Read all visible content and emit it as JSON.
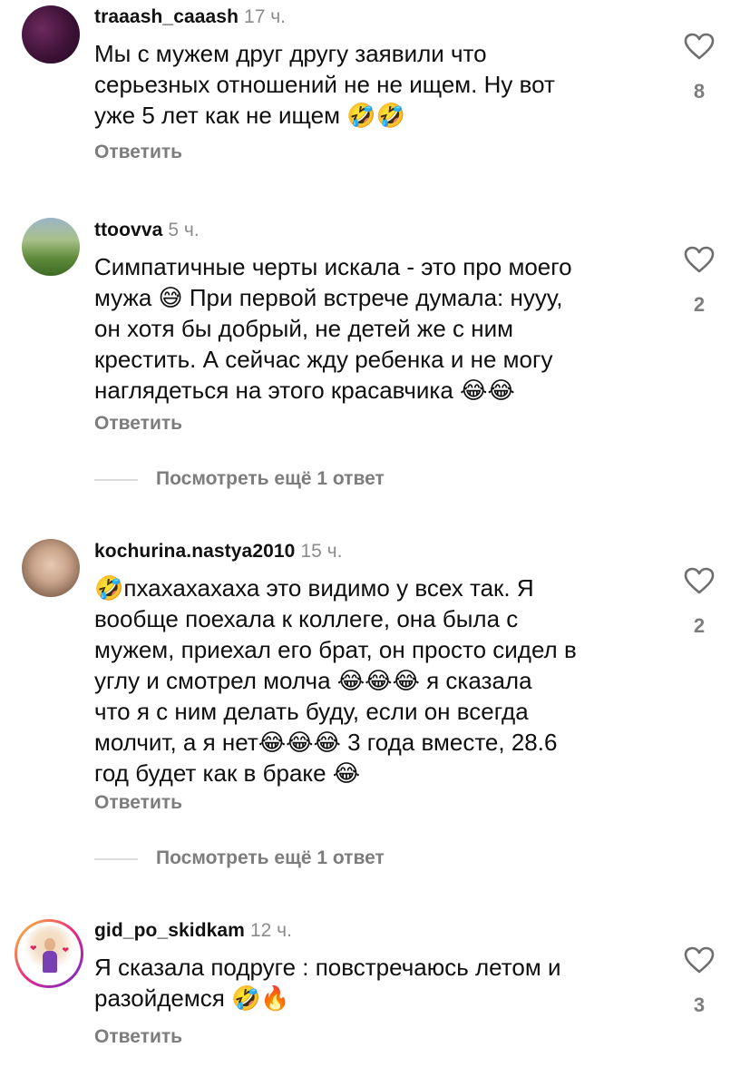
{
  "comments": [
    {
      "username": "traaash_caaash",
      "time": "17 ч.",
      "text": "Мы с мужем друг другу заявили что\nсерьезных отношений не не ищем. Ну вот\nуже 5 лет как не ищем 🤣🤣",
      "reply_label": "Ответить",
      "likes": "8"
    },
    {
      "username": "ttoovva",
      "time": "5 ч.",
      "text": "Симпатичные черты искала - это про моего\nмужа 😅 При первой встрече думала: нууу,\nон хотя бы добрый, не детей же с ним\nкрестить. А сейчас жду ребенка и не могу\nнаглядеться на этого красавчика 😂😂",
      "reply_label": "Ответить",
      "likes": "2",
      "view_more": "Посмотреть ещё 1 ответ"
    },
    {
      "username": "kochurina.nastya2010",
      "time": "15 ч.",
      "text": "🤣пхахахахаха это видимо у всех так. Я\nвообще поехала к коллеге, она была с\nмужем, приехал его брат, он просто сидел в\nуглу и смотрел молча 😂😂😂 я сказала\nчто я с ним делать буду, если он всегда\nмолчит, а я нет😂😂😂 3 года вместе, 28.6\nгод будет как в браке 😂",
      "reply_label": "Ответить",
      "likes": "2",
      "view_more": "Посмотреть ещё 1 ответ"
    },
    {
      "username": "gid_po_skidkam",
      "time": "12 ч.",
      "text": "Я сказала подруге : повстречаюсь летом и\nразойдемся 🤣🔥",
      "reply_label": "Ответить",
      "likes": "3"
    }
  ],
  "icons": {
    "like": "heart-outline-icon"
  },
  "colors": {
    "text": "#0f0f0f",
    "secondary": "#7d7d7d",
    "time": "#8b8b8b",
    "divider": "#dcdcdc"
  }
}
